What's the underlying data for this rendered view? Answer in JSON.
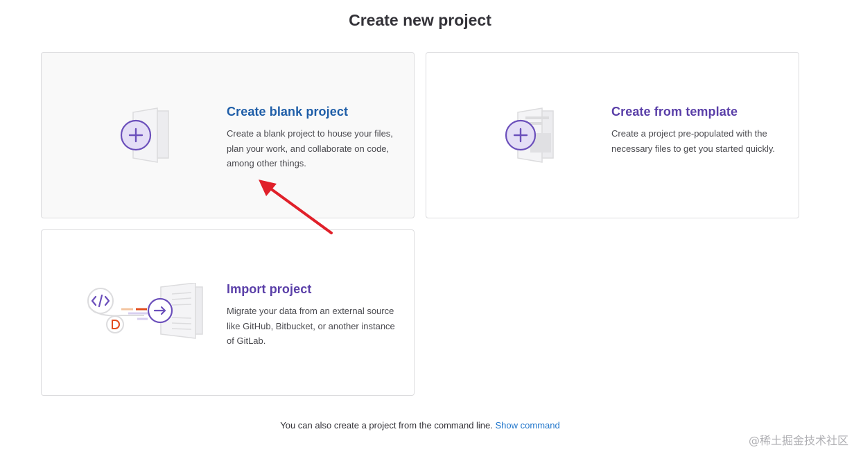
{
  "page": {
    "title": "Create new project"
  },
  "cards": [
    {
      "id": "blank",
      "title": "Create blank project",
      "description": "Create a blank project to house your files, plan your work, and collaborate on code, among other things.",
      "icon": "document-plus-icon"
    },
    {
      "id": "template",
      "title": "Create from template",
      "description": "Create a project pre-populated with the necessary files to get you started quickly.",
      "icon": "template-plus-icon"
    },
    {
      "id": "import",
      "title": "Import project",
      "description": "Migrate your data from an external source like GitHub, Bitbucket, or another instance of GitLab.",
      "icon": "import-arrow-icon"
    }
  ],
  "footer": {
    "text": "You can also create a project from the command line.",
    "link": "Show command"
  },
  "watermark": "@稀土掘金技术社区",
  "colors": {
    "accent_purple": "#6b4fbb",
    "link_blue": "#1f75cb",
    "annotation_red": "#e0202a"
  }
}
